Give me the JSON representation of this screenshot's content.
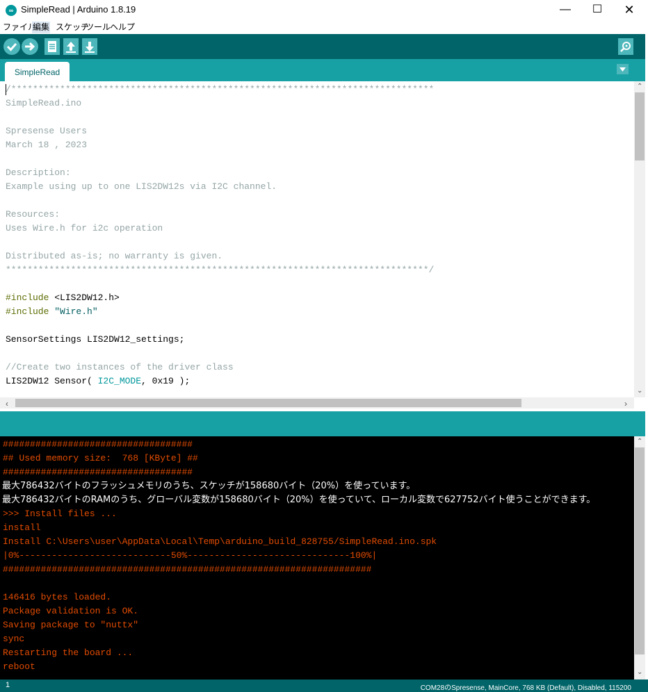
{
  "window": {
    "title": "SimpleRead | Arduino 1.8.19",
    "app_icon": "arduino-logo",
    "controls": [
      "minimize",
      "maximize",
      "close"
    ]
  },
  "menu": [
    "ファイル",
    "編集",
    "スケッチ",
    "ツール",
    "ヘルプ"
  ],
  "toolbar": {
    "buttons": [
      "verify-icon",
      "upload-icon",
      "new-icon",
      "open-icon",
      "save-icon"
    ],
    "right": "serial-monitor-icon"
  },
  "tabs": {
    "active": "SimpleRead"
  },
  "editor": {
    "lines": [
      "/******************************************************************************",
      "SimpleRead.ino",
      "",
      "Spresense Users",
      "March 18 , 2023",
      "",
      "Description:",
      "Example using up to one LIS2DW12s via I2C channel.",
      "",
      "Resources:",
      "Uses Wire.h for i2c operation",
      "",
      "Distributed as-is; no warranty is given.",
      "******************************************************************************/",
      "",
      "",
      "#include <LIS2DW12.h>",
      "#include \"Wire.h\"",
      "",
      "SensorSettings LIS2DW12_settings;",
      "",
      "//Create two instances of the driver class",
      "LIS2DW12 Sensor( I2C_MODE, 0x19 );"
    ],
    "include_kw": "#include",
    "include_lib": " <LIS2DW12.h>",
    "include_wire": " \"Wire.h\"",
    "ctor_head": "LIS2DW12 Sensor( ",
    "ctor_mode": "I2C_MODE",
    "ctor_tail": ", 0x19 );"
  },
  "console": {
    "lines": [
      "###################################",
      "## Used memory size:  768 [KByte] ##",
      "###################################",
      "最大786432バイトのフラッシュメモリのうち、スケッチが158680バイト（20%）を使っています。",
      "最大786432バイトのRAMのうち、グローバル変数が158680バイト（20%）を使っていて、ローカル変数で627752バイト使うことができます。",
      ">>> Install files ...",
      "install",
      "Install C:\\Users\\user\\AppData\\Local\\Temp\\arduino_build_828755/SimpleRead.ino.spk",
      "|0%----------------------------50%------------------------------100%|",
      "####################################################################",
      "",
      "146416 bytes loaded.",
      "Package validation is OK.",
      "Saving package to \"nuttx\"",
      "sync",
      "Restarting the board ...",
      "reboot"
    ]
  },
  "status": {
    "line": "1",
    "board": "COM28のSpresense, MainCore, 768 KB (Default), Disabled, 115200"
  },
  "colors": {
    "toolbar": "#006468",
    "tabbar": "#17a1a5",
    "console_text": "#e34c00"
  }
}
